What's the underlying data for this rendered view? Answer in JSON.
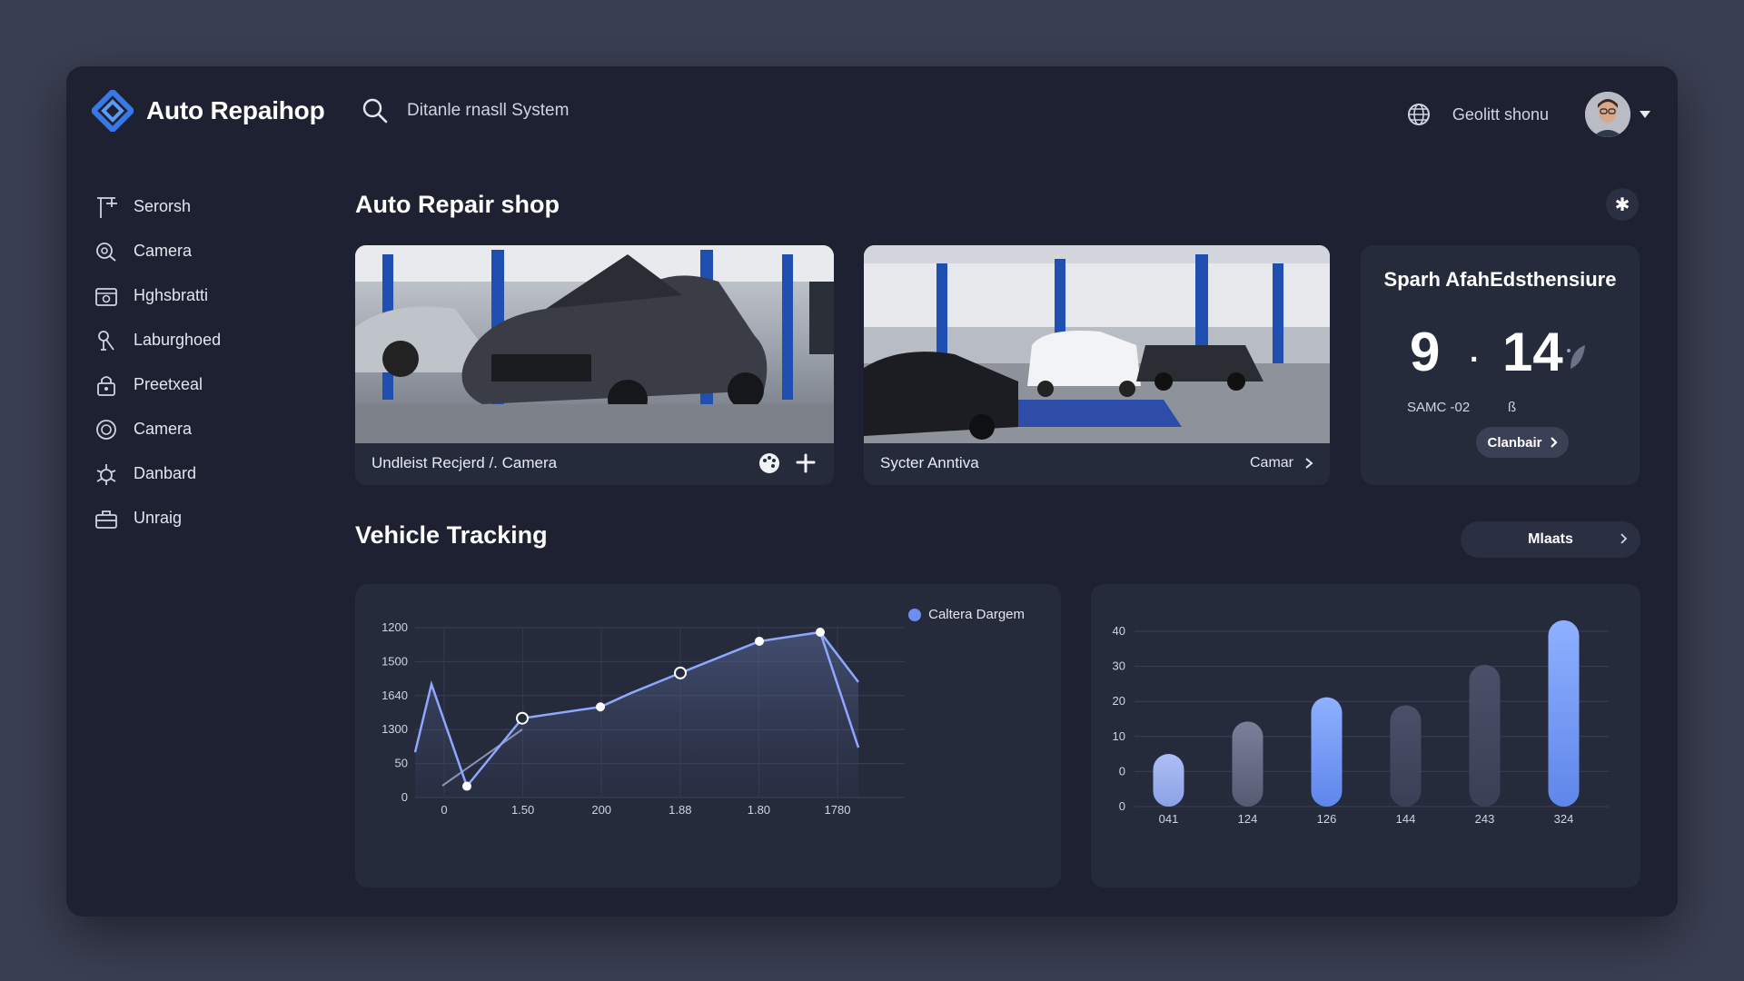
{
  "app": {
    "name": "Auto Repaihop"
  },
  "search": {
    "text": "Ditanle rnasll System"
  },
  "user": {
    "name": "Geolitt shonu"
  },
  "sidebar": {
    "items": [
      {
        "label": "Serorsh",
        "icon": "lift-icon"
      },
      {
        "label": "Camera",
        "icon": "camera-search-icon"
      },
      {
        "label": "Hghsbratti",
        "icon": "calendar-icon"
      },
      {
        "label": "Laburghoed",
        "icon": "wrench-icon"
      },
      {
        "label": "Preetxeal",
        "icon": "lock-icon"
      },
      {
        "label": "Camera",
        "icon": "camera-lens-icon"
      },
      {
        "label": "Danbard",
        "icon": "gear-bug-icon"
      },
      {
        "label": "Unraig",
        "icon": "toolbox-icon"
      }
    ]
  },
  "main": {
    "title": "Auto Repair shop",
    "cards": [
      {
        "label": "Undleist Recjerd /. Camera"
      },
      {
        "label": "Sycter Anntiva",
        "link": "Camar"
      }
    ],
    "stat": {
      "title": "Sparh AfahEdsthensiure",
      "value_a": "9",
      "sep": ".",
      "value_b": "14",
      "sub_a": "SAMC -02",
      "sub_b": "ß",
      "button": "Clanbair"
    },
    "tracking_title": "Vehicle Tracking",
    "tracking_button": "Mlaats"
  },
  "colors": {
    "accent": "#6b8ef0",
    "background": "#1d2131",
    "card": "#262b3c"
  },
  "chart_data": [
    {
      "type": "line",
      "legend": [
        "Caltera Dargem"
      ],
      "x_ticks": [
        "0",
        "1.50",
        "200",
        "1.88",
        "1.80",
        "1780"
      ],
      "y_ticks": [
        "1200",
        "1500",
        "1640",
        "1300",
        "50",
        "0"
      ],
      "series": [
        {
          "name": "Caltera Dargem",
          "values": [
            2,
            5,
            0.5,
            3.5,
            4,
            4.6,
            5.5,
            6.9,
            7.3,
            5.1
          ]
        }
      ]
    },
    {
      "type": "bar",
      "categories": [
        "041",
        "124",
        "126",
        "144",
        "243",
        "324"
      ],
      "values": [
        13,
        21,
        27,
        25,
        35,
        46
      ],
      "y_ticks": [
        "40",
        "30",
        "20",
        "10",
        "0",
        "0"
      ]
    }
  ]
}
